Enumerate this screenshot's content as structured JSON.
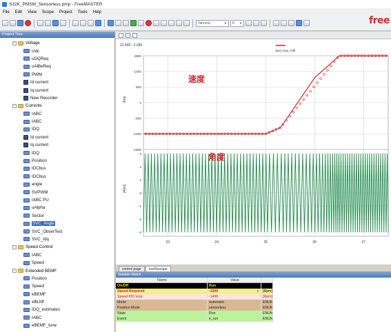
{
  "window": {
    "title": "S32K_PMSM_Sensorless.pmp - FreeMASTER"
  },
  "brand": {
    "text": "free"
  },
  "menu": [
    "File",
    "Edit",
    "View",
    "Scope",
    "Project",
    "Tools",
    "Help"
  ],
  "toolbar": {
    "font_select": "Tahoma",
    "size_select": "8"
  },
  "sidebar": {
    "title": "Project Tree",
    "items": [
      {
        "label": "Voltage",
        "kind": "folder",
        "indent": 1
      },
      {
        "label": "Udc",
        "kind": "var",
        "indent": 2
      },
      {
        "label": "uDQReq",
        "kind": "var",
        "indent": 2
      },
      {
        "label": "uAlBeReq",
        "kind": "var",
        "indent": 2
      },
      {
        "label": "PWM",
        "kind": "var",
        "indent": 2
      },
      {
        "label": "Id current",
        "kind": "rec",
        "indent": 2
      },
      {
        "label": "Iq current",
        "kind": "rec",
        "indent": 2
      },
      {
        "label": "New Recorder",
        "kind": "rec",
        "indent": 2
      },
      {
        "label": "Currents",
        "kind": "folder",
        "indent": 1
      },
      {
        "label": "IABC",
        "kind": "var",
        "indent": 2
      },
      {
        "label": "IABC",
        "kind": "var",
        "indent": 2
      },
      {
        "label": "IDQ",
        "kind": "var",
        "indent": 2
      },
      {
        "label": "Id current",
        "kind": "rec",
        "indent": 2
      },
      {
        "label": "Iq current",
        "kind": "rec",
        "indent": 2
      },
      {
        "label": "IDQ",
        "kind": "var",
        "indent": 2
      },
      {
        "label": "Position",
        "kind": "var",
        "indent": 2
      },
      {
        "label": "IDCbus",
        "kind": "var",
        "indent": 2
      },
      {
        "label": "IDCbus",
        "kind": "var",
        "indent": 2
      },
      {
        "label": "angle",
        "kind": "var",
        "indent": 2
      },
      {
        "label": "SVPWM",
        "kind": "var",
        "indent": 2
      },
      {
        "label": "IABC PU",
        "kind": "var",
        "indent": 2
      },
      {
        "label": "uAlpha",
        "kind": "var",
        "indent": 2
      },
      {
        "label": "Sector",
        "kind": "var",
        "indent": 2
      },
      {
        "label": "SVC_Angle",
        "kind": "var",
        "indent": 2,
        "selected": true
      },
      {
        "label": "SVC_ObserTest",
        "kind": "var",
        "indent": 2
      },
      {
        "label": "SVC_Idq",
        "kind": "var",
        "indent": 2
      },
      {
        "label": "Speed Control",
        "kind": "folder",
        "indent": 1
      },
      {
        "label": "IABC",
        "kind": "var",
        "indent": 2
      },
      {
        "label": "Speed",
        "kind": "var",
        "indent": 2
      },
      {
        "label": "Extended BEMF",
        "kind": "folder",
        "indent": 1
      },
      {
        "label": "Position",
        "kind": "var",
        "indent": 2
      },
      {
        "label": "Speed",
        "kind": "var",
        "indent": 2
      },
      {
        "label": "eBEMF",
        "kind": "var",
        "indent": 2
      },
      {
        "label": "eBLMf",
        "kind": "var",
        "indent": 2
      },
      {
        "label": "IDQ_estimates",
        "kind": "var",
        "indent": 2
      },
      {
        "label": "IABC",
        "kind": "var",
        "indent": 2
      },
      {
        "label": "eBEMF_tune",
        "kind": "var",
        "indent": 2
      }
    ]
  },
  "plot": {
    "header_left": "22.490 - 2.090",
    "legend_label": "Spd_loop_Fdb",
    "speed_annotation": "速度",
    "angle_annotation": "角度",
    "speed_axis_label": "Axis",
    "angle_axis_label": "[Axis]",
    "speed_color": "#d0272b",
    "angle_color": "#1f8a4c"
  },
  "chart_data": [
    {
      "type": "line",
      "title": "",
      "series": [
        {
          "name": "Spd_loop_Fdb",
          "x": [
            22.5,
            23,
            24,
            25,
            25.3,
            26,
            26.5,
            27,
            27.5
          ],
          "y": [
            -1000,
            -1000,
            -1000,
            -1000,
            -800,
            800,
            1500,
            1500,
            1500
          ]
        }
      ],
      "xlabel": "",
      "ylabel": "Axis",
      "xlim": [
        22.5,
        27.5
      ],
      "ylim": [
        -1500,
        1500
      ],
      "yticks": [
        1500,
        1000,
        500,
        0,
        -500,
        -1000,
        -1500
      ],
      "grid": true
    },
    {
      "type": "line",
      "title": "",
      "series": [
        {
          "name": "",
          "description_values": "sawtooth between -3 and 3"
        }
      ],
      "xlabel": "",
      "ylabel": "[Axis]",
      "xlim": [
        22.5,
        27.5
      ],
      "ylim": [
        -3,
        3
      ],
      "yticks": [
        3,
        2,
        1,
        0,
        -1,
        -2,
        -3
      ],
      "xticks": [
        23,
        24,
        25,
        26,
        27
      ],
      "grid": true
    }
  ],
  "tabs": [
    "control page",
    "oscilloscope"
  ],
  "watch": {
    "title": "Variable Watch",
    "columns": [
      "Name",
      "Value",
      ""
    ],
    "rows": [
      {
        "name": "On/Off",
        "value": "Run",
        "unit": "",
        "extra": "",
        "style": "black"
      },
      {
        "name": "Speed Required",
        "value": "-1500",
        "unit": "[Rpm]",
        "extra": "",
        "style": "yellow",
        "dropdown": true
      },
      {
        "name": "Speed PID loop",
        "value": "-1496",
        "unit": "[Rpm]",
        "extra": "",
        "style": "pink"
      },
      {
        "name": "Mode",
        "value": "automatic",
        "unit": "ENUM",
        "extra": "",
        "style": "tan"
      },
      {
        "name": "Position Mode",
        "value": "sensorless",
        "unit": "ENUM",
        "extra": "",
        "style": "tan"
      },
      {
        "name": "State",
        "value": "Run",
        "unit": "ENUM",
        "extra": "",
        "style": "green"
      },
      {
        "name": "Event",
        "value": "e_run",
        "unit": "ENUM",
        "extra": "",
        "style": "green"
      }
    ]
  }
}
